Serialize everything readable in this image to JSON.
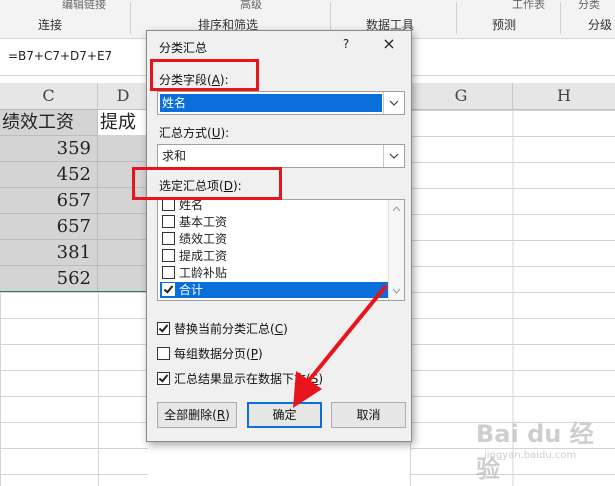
{
  "ribbon": {
    "top_fragments": {
      "left": "编辑链接",
      "mid": "高级",
      "right1": "工作表",
      "right2": "分类"
    },
    "groups": [
      "连接",
      "排序和筛选",
      "数据工具",
      "预测",
      "分级"
    ]
  },
  "formula_bar": {
    "formula": "=B7+C7+D7+E7"
  },
  "sheet": {
    "columns": [
      "C",
      "D",
      "G",
      "H"
    ],
    "header_row": {
      "c": "绩效工资",
      "d": "提成工"
    },
    "values_c": [
      "359",
      "452",
      "657",
      "657",
      "381",
      "562"
    ]
  },
  "dialog": {
    "title": "分类汇总",
    "help": "?",
    "close": "×",
    "field_label": {
      "text": "分类字段(",
      "key": "A",
      "tail": "):"
    },
    "field_value": "姓名",
    "method_label": {
      "text": "汇总方式(",
      "key": "U",
      "tail": "):"
    },
    "method_value": "求和",
    "items_label": {
      "text": "选定汇总项(",
      "key": "D",
      "tail": "):"
    },
    "items": [
      {
        "label": "姓名",
        "checked": false,
        "selected": false
      },
      {
        "label": "基本工资",
        "checked": false,
        "selected": false
      },
      {
        "label": "绩效工资",
        "checked": false,
        "selected": false
      },
      {
        "label": "提成工资",
        "checked": false,
        "selected": false
      },
      {
        "label": "工龄补贴",
        "checked": false,
        "selected": false
      },
      {
        "label": "合计",
        "checked": true,
        "selected": true
      }
    ],
    "options": [
      {
        "text": "替换当前分类汇总(",
        "key": "C",
        "tail": ")",
        "checked": true
      },
      {
        "text": "每组数据分页(",
        "key": "P",
        "tail": ")",
        "checked": false
      },
      {
        "text": "汇总结果显示在数据下方(",
        "key": "S",
        "tail": ")",
        "checked": true
      }
    ],
    "buttons": {
      "delete_all": {
        "text": "全部删除(",
        "key": "R",
        "tail": ")"
      },
      "ok": "确定",
      "cancel": "取消"
    }
  },
  "watermark": {
    "logo": "Bai du 经验",
    "url": "jingyan.baidu.com"
  },
  "colors": {
    "highlight": "#e8141b",
    "selection": "#0a6fdb",
    "sheet_selection": "#d4d4d4"
  }
}
